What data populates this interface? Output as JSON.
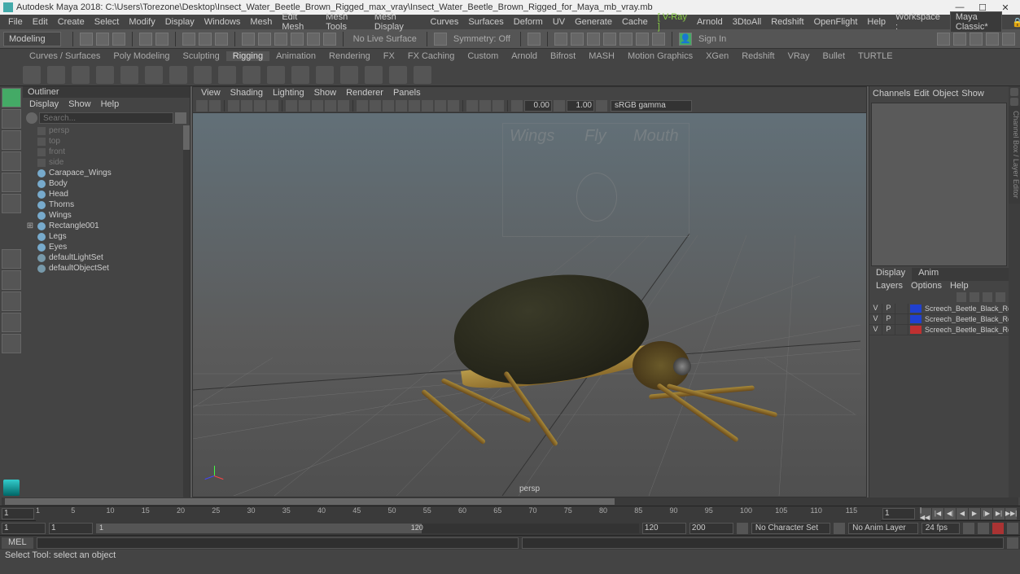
{
  "title": "Autodesk Maya 2018: C:\\Users\\Torezone\\Desktop\\Insect_Water_Beetle_Brown_Rigged_max_vray\\Insect_Water_Beetle_Brown_Rigged_for_Maya_mb_vray.mb",
  "menu": [
    "File",
    "Edit",
    "Create",
    "Select",
    "Modify",
    "Display",
    "Windows",
    "Mesh",
    "Edit Mesh",
    "Mesh Tools",
    "Mesh Display",
    "Curves",
    "Surfaces",
    "Deform",
    "UV",
    "Generate",
    "Cache"
  ],
  "menu_green": "[ V-Ray ]",
  "menu2": [
    "Arnold",
    "3DtoAll",
    "Redshift",
    "OpenFlight",
    "Help"
  ],
  "workspace_lbl": "Workspace :",
  "workspace_val": "Maya Classic*",
  "mode": "Modeling",
  "surface_dd": "No Live Surface",
  "sym_lbl": "Symmetry: Off",
  "signin": "Sign In",
  "shelves": [
    "Curves / Surfaces",
    "Poly Modeling",
    "Sculpting",
    "Rigging",
    "Animation",
    "Rendering",
    "FX",
    "FX Caching",
    "Custom",
    "Arnold",
    "Bifrost",
    "MASH",
    "Motion Graphics",
    "XGen",
    "Redshift",
    "VRay",
    "Bullet",
    "TURTLE"
  ],
  "shelf_active": "Rigging",
  "outliner": {
    "title": "Outliner",
    "menu": [
      "Display",
      "Show",
      "Help"
    ],
    "search_ph": "Search...",
    "items": [
      {
        "label": "persp",
        "type": "cam",
        "dim": true
      },
      {
        "label": "top",
        "type": "cam",
        "dim": true
      },
      {
        "label": "front",
        "type": "cam",
        "dim": true
      },
      {
        "label": "side",
        "type": "cam",
        "dim": true
      },
      {
        "label": "Carapace_Wings",
        "type": "mesh"
      },
      {
        "label": "Body",
        "type": "mesh"
      },
      {
        "label": "Head",
        "type": "mesh"
      },
      {
        "label": "Thorns",
        "type": "mesh"
      },
      {
        "label": "Wings",
        "type": "mesh"
      },
      {
        "label": "Rectangle001",
        "type": "mesh",
        "exp": true
      },
      {
        "label": "Legs",
        "type": "mesh"
      },
      {
        "label": "Eyes",
        "type": "mesh"
      },
      {
        "label": "defaultLightSet",
        "type": "set"
      },
      {
        "label": "defaultObjectSet",
        "type": "set"
      }
    ]
  },
  "viewport": {
    "menu": [
      "View",
      "Shading",
      "Lighting",
      "Show",
      "Renderer",
      "Panels"
    ],
    "exposure": "0.00",
    "gamma": "1.00",
    "colorspace": "sRGB gamma",
    "camera": "persp",
    "hud": {
      "a": "Wings",
      "b": "Fly",
      "c": "Mouth"
    }
  },
  "channelbox": {
    "menu": [
      "Channels",
      "Edit",
      "Object",
      "Show"
    ],
    "tabs": {
      "a": "Display",
      "b": "Anim"
    },
    "submenu": [
      "Layers",
      "Options",
      "Help"
    ],
    "layers": [
      {
        "v": "V",
        "p": "P",
        "color": "#2040d0",
        "name": "Screech_Beetle_Black_Realistic"
      },
      {
        "v": "V",
        "p": "P",
        "color": "#2040d0",
        "name": "Screech_Beetle_Black_Realistic"
      },
      {
        "v": "V",
        "p": "P",
        "color": "#c03030",
        "name": "Screech_Beetle_Black_Realistic"
      }
    ]
  },
  "vtab": "Channel Box / Layer Editor",
  "time": {
    "cur": "1",
    "ticks": [
      "1",
      "5",
      "10",
      "15",
      "20",
      "25",
      "30",
      "35",
      "40",
      "45",
      "50",
      "55",
      "60",
      "65",
      "70",
      "75",
      "80",
      "85",
      "90",
      "95",
      "100",
      "105",
      "110",
      "115",
      "120"
    ],
    "end_field": "1"
  },
  "range": {
    "a": "1",
    "b": "1",
    "seg_a": "1",
    "seg_b": "120",
    "c": "120",
    "d": "200",
    "charset": "No Character Set",
    "animlayer": "No Anim Layer",
    "fps": "24 fps"
  },
  "cmd": {
    "lbl": "MEL"
  },
  "status": "Select Tool: select an object"
}
